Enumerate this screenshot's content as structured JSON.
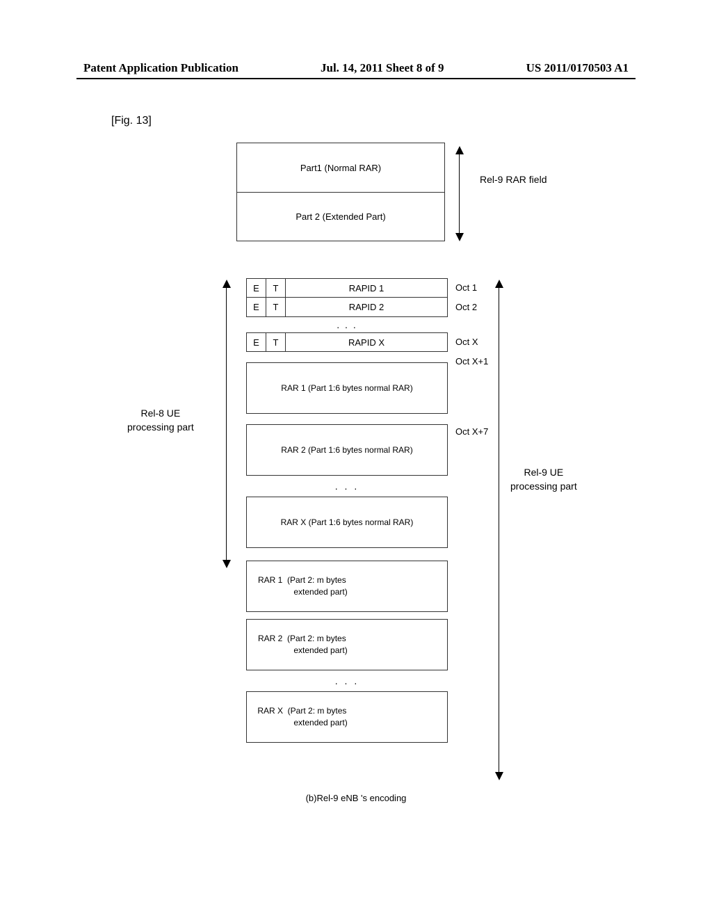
{
  "header": {
    "left": "Patent Application Publication",
    "mid": "Jul. 14, 2011  Sheet 8 of 9",
    "right": "US 2011/0170503 A1"
  },
  "figure_label": "[Fig. 13]",
  "upper": {
    "part1": "Part1  (Normal RAR)",
    "part2": "Part 2  (Extended Part)",
    "side_label": "Rel-9 RAR field"
  },
  "diagram": {
    "header_rows": [
      {
        "e": "E",
        "t": "T",
        "rapid": "RAPID 1",
        "oct": "Oct 1"
      },
      {
        "e": "E",
        "t": "T",
        "rapid": "RAPID 2",
        "oct": "Oct 2"
      }
    ],
    "header_ell": ". . .",
    "header_last": {
      "e": "E",
      "t": "T",
      "rapid": "RAPID X",
      "oct": "Oct X"
    },
    "oct_xp1": "Oct X+1",
    "rar_part1": [
      "RAR 1 (Part 1:6 bytes normal RAR)",
      "RAR 2 (Part 1:6 bytes normal RAR)"
    ],
    "oct_xp7": "Oct X+7",
    "rar_part1_ell": ". . .",
    "rar_part1_last": "RAR X (Part 1:6 bytes normal RAR)",
    "rar_part2": [
      "RAR 1  (Part 2: m bytes\n                extended part)",
      "RAR 2  (Part 2: m bytes\n                extended part)"
    ],
    "rar_part2_ell": ". . .",
    "rar_part2_last": "RAR X  (Part 2: m bytes\n                extended part)",
    "left_label": "Rel-8 UE\nprocessing part",
    "right_label": "Rel-9 UE\nprocessing part",
    "caption": "(b)Rel-9 eNB 's encoding"
  }
}
